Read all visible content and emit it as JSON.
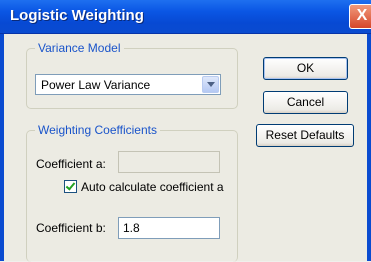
{
  "window": {
    "title": "Logistic Weighting",
    "close_glyph": "X"
  },
  "variance_group": {
    "label": "Variance Model",
    "selected": "Power Law Variance"
  },
  "weighting_group": {
    "label": "Weighting Coefficients",
    "coef_a_label": "Coefficient a:",
    "coef_a_value": "",
    "auto_calc_label": "Auto calculate coefficient a",
    "auto_calc_checked": true,
    "coef_b_label": "Coefficient b:",
    "coef_b_value": "1.8"
  },
  "buttons": {
    "ok": "OK",
    "cancel": "Cancel",
    "reset": "Reset Defaults"
  },
  "colors": {
    "titlebar": "#0a56e4",
    "group_label": "#1a54ca",
    "close": "#d6462a",
    "check": "#21a121"
  }
}
